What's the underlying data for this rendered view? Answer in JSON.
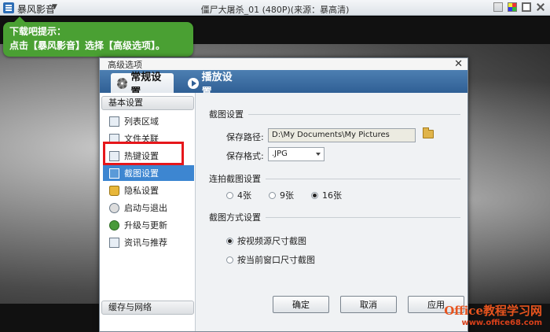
{
  "player": {
    "app_name": "暴风影音",
    "video_title": "僵尸大屠杀_01 (480P)(来源：暴高清)"
  },
  "tip": {
    "title": "下载吧提示：",
    "body": "点击【暴风影音】选择【高级选项】。"
  },
  "dialog": {
    "title": "高级选项",
    "tabs": [
      {
        "label": "常规设置",
        "active": true
      },
      {
        "label": "播放设置",
        "active": false
      }
    ],
    "sidebar": {
      "header_basic": "基本设置",
      "items": [
        {
          "label": "列表区域",
          "icon": "list-icon"
        },
        {
          "label": "文件关联",
          "icon": "file-icon"
        },
        {
          "label": "热键设置",
          "icon": "hotkey-icon"
        },
        {
          "label": "截图设置",
          "icon": "camera-icon",
          "active": true
        },
        {
          "label": "隐私设置",
          "icon": "lock-icon"
        },
        {
          "label": "启动与退出",
          "icon": "power-icon"
        },
        {
          "label": "升级与更新",
          "icon": "update-globe-icon"
        },
        {
          "label": "资讯与推荐",
          "icon": "news-icon"
        }
      ],
      "header_cache": "缓存与网络"
    },
    "content": {
      "section_screenshot": "截图设置",
      "save_path_label": "保存路径:",
      "save_path_value": "D:\\My Documents\\My Pictures",
      "save_format_label": "保存格式:",
      "save_format_value": ".JPG",
      "section_burst": "连拍截图设置",
      "burst_options": [
        {
          "label": "4张",
          "checked": false
        },
        {
          "label": "9张",
          "checked": false
        },
        {
          "label": "16张",
          "checked": true
        }
      ],
      "section_mode": "截图方式设置",
      "mode_options": [
        {
          "label": "按视频源尺寸截图",
          "checked": true
        },
        {
          "label": "按当前窗口尺寸截图",
          "checked": false
        }
      ]
    },
    "buttons": {
      "ok": "确定",
      "cancel": "取消",
      "apply": "应用"
    }
  },
  "watermark": {
    "line1": "Office教程学习网",
    "line2": "www.office68.com"
  }
}
